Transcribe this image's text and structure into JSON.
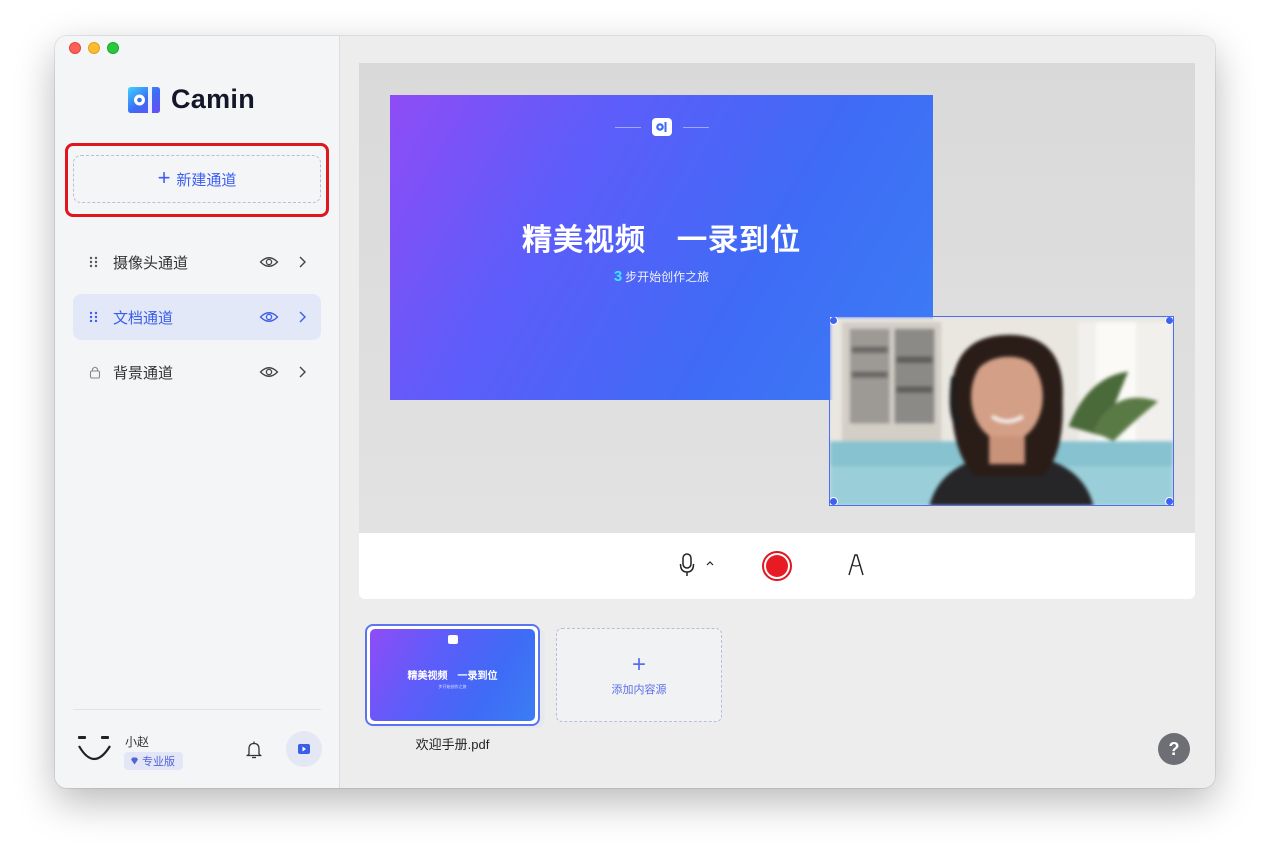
{
  "app": {
    "name": "Camin"
  },
  "sidebar": {
    "new_channel_label": "新建通道",
    "channels": [
      {
        "label": "摄像头通道",
        "active": false,
        "icon": "drag-handle-icon"
      },
      {
        "label": "文档通道",
        "active": true,
        "icon": "drag-handle-icon"
      },
      {
        "label": "背景通道",
        "active": false,
        "icon": "lock-icon"
      }
    ],
    "user": {
      "name": "小赵",
      "plan": "专业版"
    }
  },
  "preview": {
    "slide": {
      "title": "精美视频　一录到位",
      "subtitle_number": "3",
      "subtitle": "步开始创作之旅"
    }
  },
  "controls": {
    "mic_icon": "microphone-icon",
    "record_icon": "record-icon",
    "pen_icon": "pen-icon"
  },
  "sources": {
    "items": [
      {
        "name": "欢迎手册.pdf",
        "thumb_title": "精美视频　一录到位"
      }
    ],
    "add_label": "添加内容源"
  },
  "help_label": "?",
  "colors": {
    "accent": "#3d5ef2",
    "record": "#e81b24",
    "highlight": "#e0151e",
    "active_bg": "#e3e8f8"
  }
}
